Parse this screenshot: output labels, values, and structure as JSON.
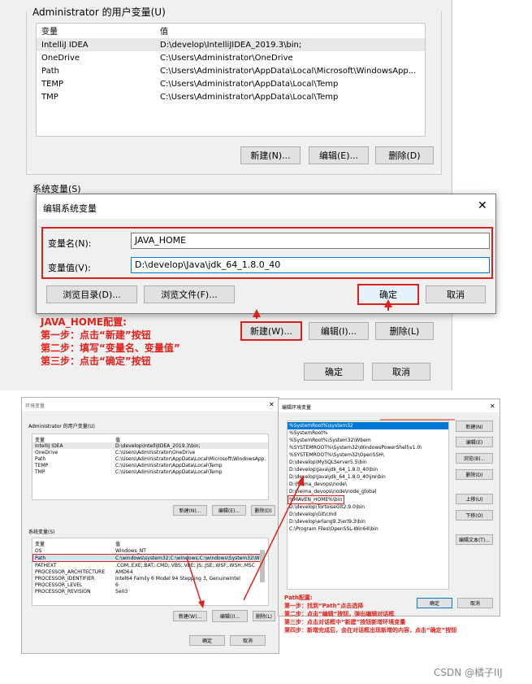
{
  "top": {
    "user_group_label": "Administrator 的用户变量(U)",
    "columns": [
      "变量",
      "值"
    ],
    "user_vars": [
      {
        "name": "IntelliJ IDEA",
        "value": "D:\\develop\\IntelliJIDEA_2019.3\\bin;"
      },
      {
        "name": "OneDrive",
        "value": "C:\\Users\\Administrator\\OneDrive"
      },
      {
        "name": "Path",
        "value": "C:\\Users\\Administrator\\AppData\\Local\\Microsoft\\WindowsApp..."
      },
      {
        "name": "TEMP",
        "value": "C:\\Users\\Administrator\\AppData\\Local\\Temp"
      },
      {
        "name": "TMP",
        "value": "C:\\Users\\Administrator\\AppData\\Local\\Temp"
      }
    ],
    "user_buttons": {
      "new": "新建(N)...",
      "edit": "编辑(E)...",
      "delete": "删除(D)"
    },
    "system_group_label": "系统变量(S)",
    "system_buttons": {
      "new": "新建(W)...",
      "edit": "编辑(I)...",
      "delete": "删除(L)"
    },
    "footer_buttons": {
      "ok": "确定",
      "cancel": "取消"
    }
  },
  "edit_dialog": {
    "title": "编辑系统变量",
    "close": "✕",
    "name_label": "变量名(N):",
    "name_value": "JAVA_HOME",
    "value_label": "变量值(V):",
    "value_value": "D:\\develop\\Java\\jdk_64_1.8.0_40",
    "browse_dir": "浏览目录(D)...",
    "browse_file": "浏览文件(F)...",
    "ok": "确定",
    "cancel": "取消"
  },
  "java_note": {
    "title": "JAVA_HOME配置:",
    "step1": "第一步：点击“新建”按钮",
    "step2": "第二步：填写“变量名、变量值”",
    "step3": "第三步：点击“确定”按钮"
  },
  "bottom_left": {
    "title": "环境变量",
    "close": "✕",
    "user_group_label": "Administrator 的用户变量(U)",
    "columns": [
      "变量",
      "值"
    ],
    "user_vars": [
      {
        "name": "IntelliJ IDEA",
        "value": "D:\\develop\\IntelliJIDEA_2019.3\\bin;"
      },
      {
        "name": "OneDrive",
        "value": "C:\\Users\\Administrator\\OneDrive"
      },
      {
        "name": "Path",
        "value": "C:\\Users\\Administrator\\AppData\\Local\\Microsoft\\WindowsApp..."
      },
      {
        "name": "TEMP",
        "value": "C:\\Users\\Administrator\\AppData\\Local\\Temp"
      },
      {
        "name": "TMP",
        "value": "C:\\Users\\Administrator\\AppData\\Local\\Temp"
      }
    ],
    "user_buttons": {
      "new": "新建(N)...",
      "edit": "编辑(E)...",
      "delete": "删除(D)"
    },
    "system_group_label": "系统变量(S)",
    "sys_columns": [
      "变量",
      "值"
    ],
    "sys_vars": [
      {
        "name": "OS",
        "value": "Windows_NT"
      },
      {
        "name": "Path",
        "value": "C:\\windows\\system32;C:\\windows;C:\\windows\\System32\\Wbe..."
      },
      {
        "name": "PATHEXT",
        "value": ".COM;.EXE;.BAT;.CMD;.VBS;.VBE;.JS;.JSE;.WSF;.WSH;.MSC"
      },
      {
        "name": "PROCESSOR_ARCHITECTURE",
        "value": "AMD64"
      },
      {
        "name": "PROCESSOR_IDENTIFIER",
        "value": "Intel64 Family 6 Model 94 Stepping 3, GenuineIntel"
      },
      {
        "name": "PROCESSOR_LEVEL",
        "value": "6"
      },
      {
        "name": "PROCESSOR_REVISION",
        "value": "5e03"
      }
    ],
    "sys_buttons": {
      "new": "新建(W)...",
      "edit": "编辑(I)...",
      "delete": "删除(L)"
    },
    "footer_buttons": {
      "ok": "确定",
      "cancel": "取消"
    }
  },
  "bottom_right": {
    "title": "编辑环境变量",
    "close": "✕",
    "paths": [
      "%SystemRoot%\\system32",
      "%SystemRoot%",
      "%SystemRoot%\\System32\\Wbem",
      "%SYSTEMROOT%\\System32\\WindowsPowerShell\\v1.0\\",
      "%SYSTEMROOT%\\System32\\OpenSSH\\",
      "D:\\develop\\MySQLServer5.5\\bin",
      "D:\\develop\\Java\\jdk_64_1.8.0_40\\bin",
      "D:\\develop\\Java\\jdk_64_1.8.0_40\\jre\\bin",
      "D:\\heima_devops\\node\\",
      "D:\\heima_devops\\node\\node_global",
      "%MAVEN_HOME%\\bin",
      "D:\\develop\\TortoiseGit2.9.0\\bin",
      "D:\\develop\\Git\\cmd",
      "D:\\develop\\erlang9.3\\erl9.3\\bin",
      "C:\\Program Files\\OpenSSL-Win64\\bin"
    ],
    "buttons": [
      "新建(N)",
      "编辑(E)",
      "浏览(B)...",
      "删除(D)",
      "上移(U)",
      "下移(O)",
      "编辑文本(T)..."
    ],
    "ok": "确定",
    "cancel": "取消"
  },
  "path_note": {
    "title": "Path配置:",
    "step1": "第一步：找到“Path”点击选择",
    "step2": "第二步：点击“编辑”按钮，弹出编辑对话框",
    "step3": "第三步：点击对话框中“新建”按钮新增环境变量",
    "step4": "第四步：新增完成后，会在对话框出现新增的内容，点击“确定”按钮"
  },
  "watermark": "CSDN @橘子IIJ",
  "colors": {
    "accent_red": "#e0201a",
    "selected_row": "#cce8ff",
    "button_gray": "#e1e1e1",
    "dialog_border": "#7a7a7a"
  }
}
